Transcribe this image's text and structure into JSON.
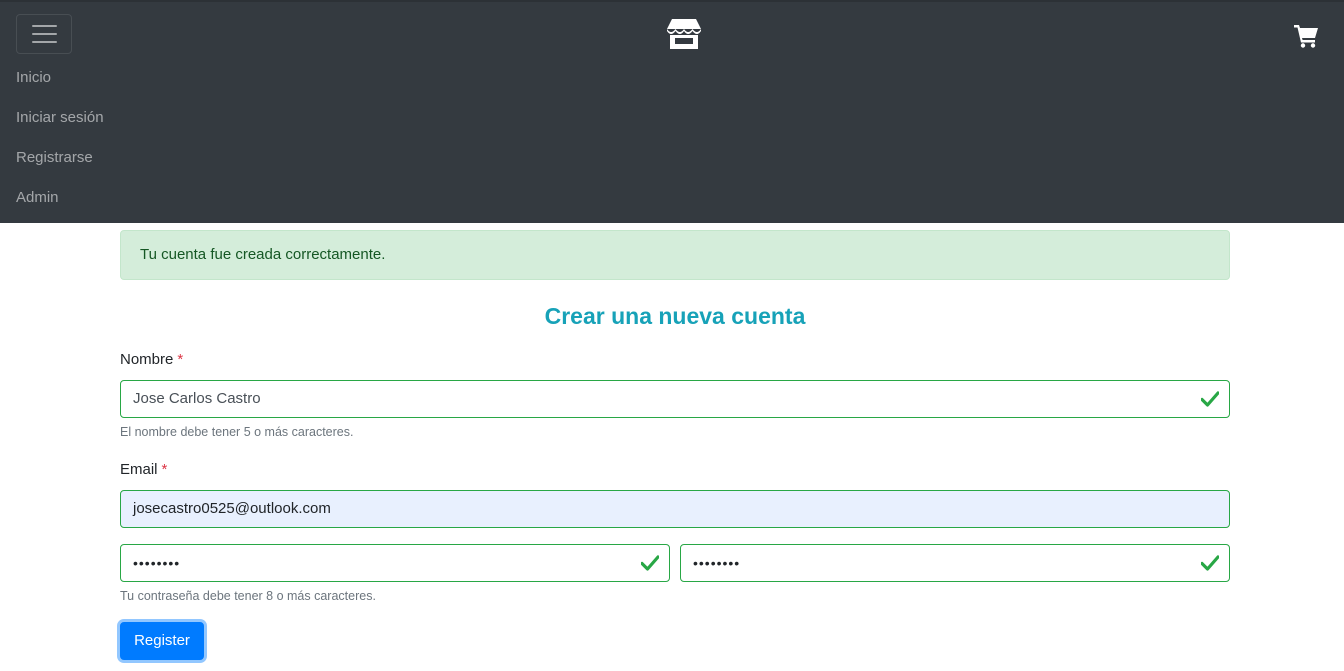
{
  "navbar": {
    "toggle_icon": "hamburger-menu-icon",
    "brand_icon": "store-icon",
    "cart_icon": "shopping-cart-icon",
    "links": [
      "Inicio",
      "Iniciar sesión",
      "Registrarse",
      "Admin"
    ],
    "background": "#343a40"
  },
  "alert": {
    "message": "Tu cuenta fue creada correctamente.",
    "background": "#d4edda",
    "color": "#155724"
  },
  "form": {
    "title": "Crear una nueva cuenta",
    "name": {
      "label": "Nombre",
      "required_mark": "*",
      "value": "Jose Carlos Castro",
      "help": "El nombre debe tener 5 o más caracteres."
    },
    "email": {
      "label": "Email",
      "required_mark": "*",
      "value": "josecastro0525@outlook.com"
    },
    "password": {
      "masked_value": "••••••••",
      "help": "Tu contraseña debe tener 8 o más caracteres."
    },
    "password_confirm": {
      "masked_value": "••••••••"
    },
    "valid_icon": "check-icon",
    "valid_color": "#28a745",
    "submit_label": "Register",
    "submit_color": "#007bff"
  }
}
